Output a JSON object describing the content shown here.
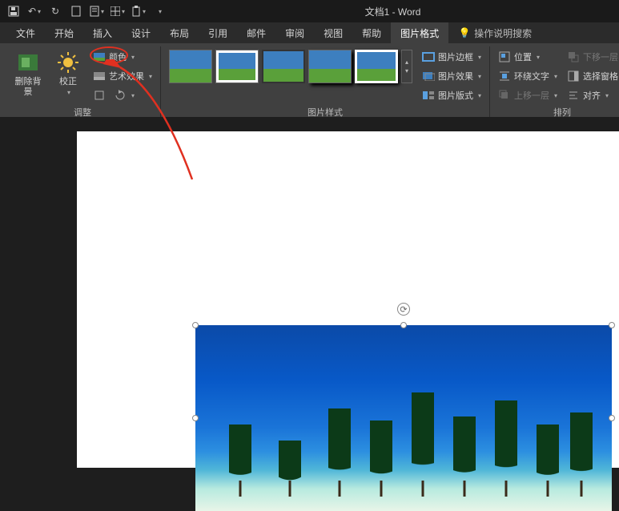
{
  "title": "文档1 - Word",
  "qat": {
    "save": "💾",
    "undo": "↶",
    "redo": "↻"
  },
  "tabs": {
    "file": "文件",
    "home": "开始",
    "insert": "插入",
    "design": "设计",
    "layout": "布局",
    "references": "引用",
    "mail": "邮件",
    "review": "审阅",
    "view": "视图",
    "help": "帮助",
    "picture_format": "图片格式",
    "tell_me": "操作说明搜索"
  },
  "ribbon": {
    "adjust": {
      "remove_bg": "删除背景",
      "corrections": "校正",
      "color": "颜色",
      "artistic": "艺术效果",
      "group_label": "调整"
    },
    "styles": {
      "group_label": "图片样式",
      "border": "图片边框",
      "effects": "图片效果",
      "layout": "图片版式"
    },
    "arrange": {
      "position": "位置",
      "wrap": "环绕文字",
      "forward": "上移一层",
      "backward": "下移一层",
      "selection_pane": "选择窗格",
      "align": "对齐",
      "group_label": "排列"
    }
  },
  "annotation": {
    "circled": "color-button"
  }
}
